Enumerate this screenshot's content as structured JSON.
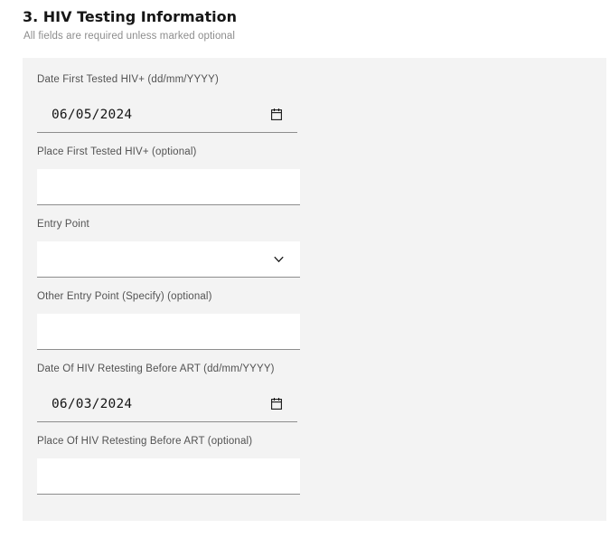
{
  "section": {
    "title": "3. HIV Testing Information",
    "subtitle": "All fields are required unless marked optional"
  },
  "fields": {
    "date_first_tested": {
      "label": "Date First Tested HIV+ (dd/mm/YYYY)",
      "value": "06/05/2024",
      "icon": "calendar-icon"
    },
    "place_first_tested": {
      "label": "Place First Tested HIV+ (optional)",
      "value": ""
    },
    "entry_point": {
      "label": "Entry Point",
      "selected": "",
      "icon": "chevron-down-icon"
    },
    "other_entry_point": {
      "label": "Other Entry Point (Specify) (optional)",
      "value": ""
    },
    "date_retesting": {
      "label": "Date Of HIV Retesting Before ART (dd/mm/YYYY)",
      "value": "06/03/2024",
      "icon": "calendar-icon"
    },
    "place_retesting": {
      "label": "Place Of HIV Retesting Before ART (optional)",
      "value": ""
    }
  },
  "colors": {
    "panel_background": "#f3f3f3",
    "input_background": "#ffffff",
    "input_border": "#8d8d8d",
    "label_text": "#525252",
    "subtitle_text": "#8d8d8d",
    "title_text": "#161616"
  }
}
